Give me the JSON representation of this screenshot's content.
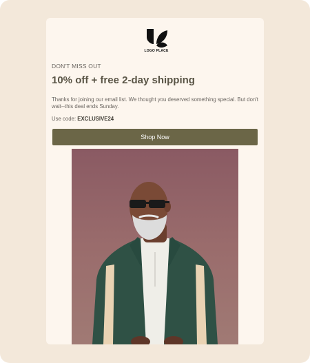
{
  "brand": {
    "logo_text": "LOGO PLACE"
  },
  "email": {
    "eyebrow": "DON'T MISS OUT",
    "headline": "10% off + free 2-day shipping",
    "body": "Thanks for joining our email list. We thought you deserved something special. But don't wait--this deal ends Sunday.",
    "code_label": "Use code:",
    "code": "EXCLUSIVE24",
    "cta_label": "Shop Now"
  },
  "colors": {
    "page_bg": "#f3e8da",
    "card_bg": "#fdf6ee",
    "cta_bg": "#6b6647",
    "headline": "#5a5546",
    "hero_bg": "#9a6c6c",
    "jacket": "#2f5145"
  },
  "icons": {
    "logo": "leaf-logo-icon"
  }
}
